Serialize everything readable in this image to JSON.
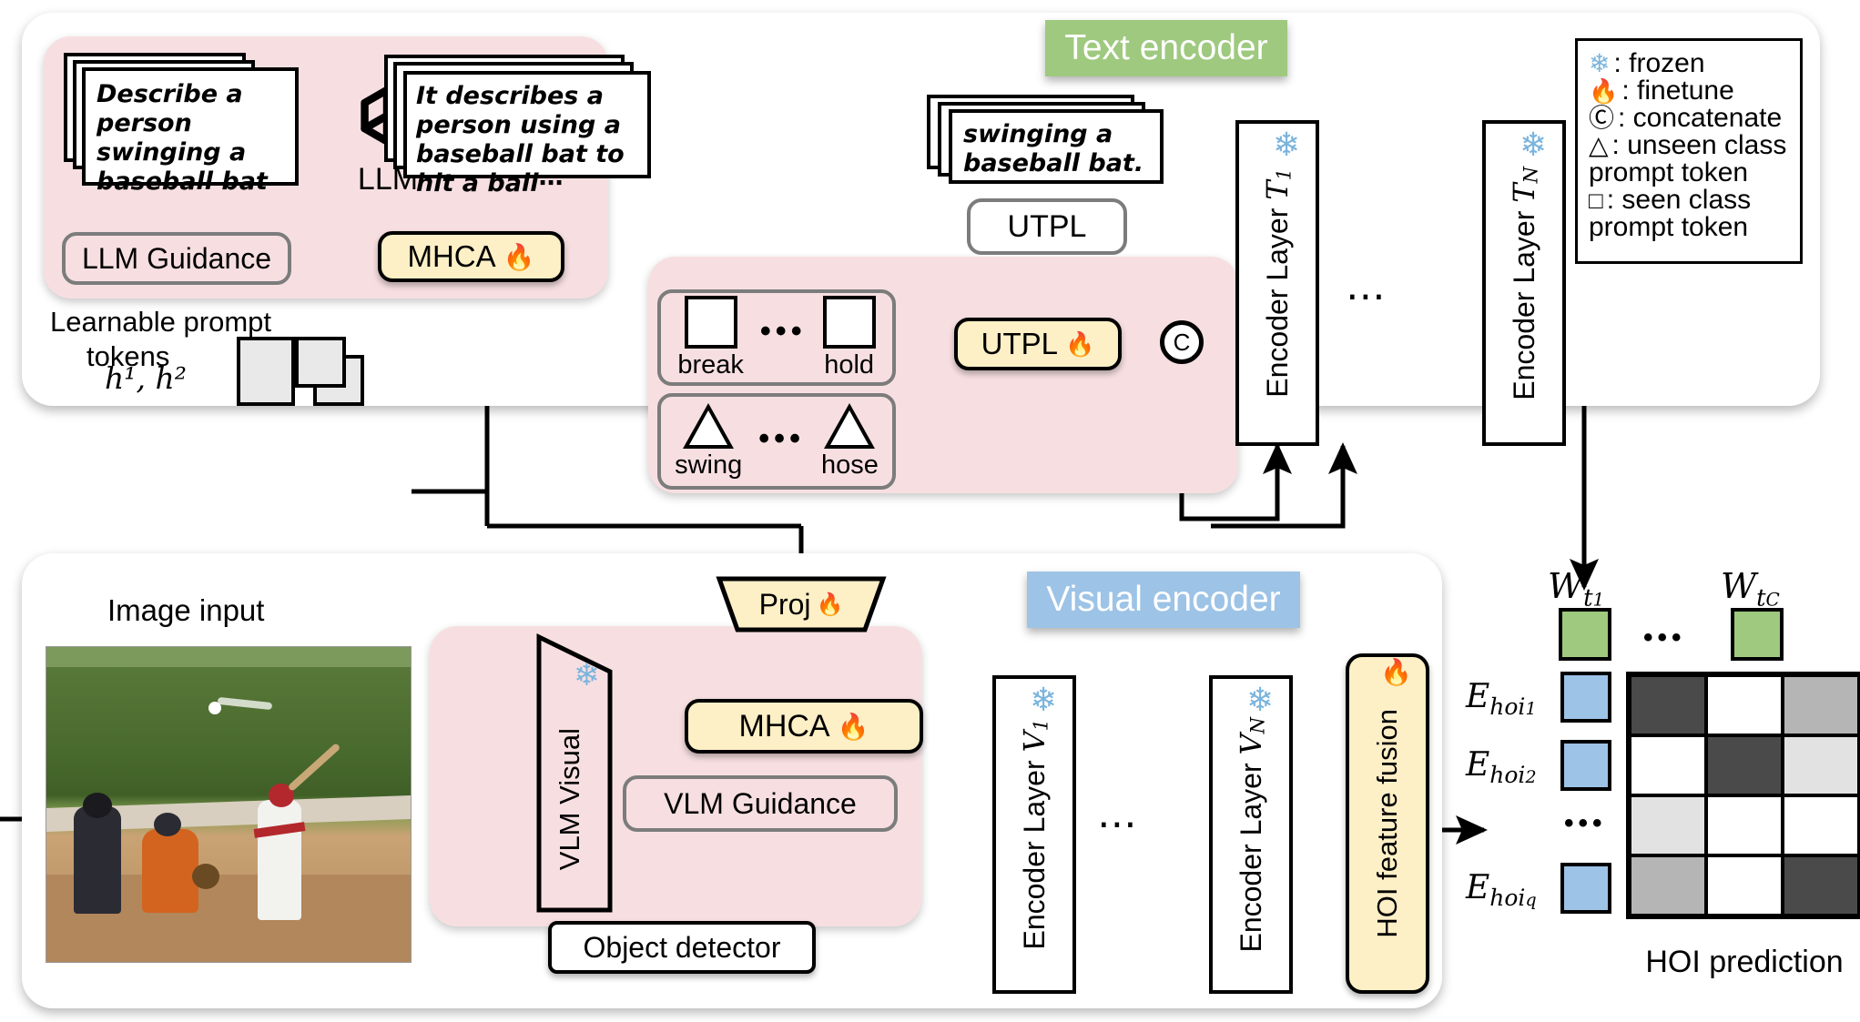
{
  "figure": {
    "text_encoder_tag": "Text encoder",
    "visual_encoder_tag": "Visual encoder",
    "text_encoder_color": "#9ec97f",
    "visual_encoder_color": "#9dc3e6"
  },
  "legend": {
    "items": [
      {
        "icon": "snowflake-icon",
        "glyph": "❄",
        "text": ": frozen"
      },
      {
        "icon": "fire-icon",
        "glyph": "🔥",
        "text": ": finetune"
      },
      {
        "icon": "concat-circle-icon",
        "glyph": "Ⓒ",
        "text": ": concatenate"
      },
      {
        "icon": "triangle-icon",
        "glyph": "△",
        "text": ": unseen class"
      },
      {
        "icon": "none",
        "glyph": "",
        "text": "prompt token"
      },
      {
        "icon": "square-icon",
        "glyph": "□",
        "text": ": seen class"
      },
      {
        "icon": "none",
        "glyph": "",
        "text": "prompt token"
      }
    ]
  },
  "llm_guidance": {
    "prompt_doc": "Describe a person swinging a baseball bat",
    "llm_label": "LLM",
    "llm_icon": "openai-logo-icon",
    "response_doc": "It describes a person using a baseball bat to hit a ball⋯",
    "group_label": "LLM Guidance",
    "mhca_label": "MHCA",
    "mhca_icon": "fire-icon"
  },
  "learnable_prompts": {
    "caption_line1": "Learnable prompt",
    "caption_line2": "tokens",
    "math": "h¹, h²"
  },
  "prompt_tokens": {
    "seen": {
      "left_label": "break",
      "right_label": "hold",
      "dots": "•••",
      "shape": "square"
    },
    "unseen": {
      "left_label": "swing",
      "right_label": "hose",
      "dots": "•••",
      "shape": "triangle"
    },
    "utpl_frozen_label": "UTPL",
    "utpl_finetune_label": "UTPL",
    "utpl_icon": "fire-icon",
    "concat_glyph": "C"
  },
  "text_branch": {
    "sentence_doc": "swinging a baseball bat.",
    "encoder_first": "Encoder Layer T₁",
    "encoder_first_base": "Encoder Layer ",
    "encoder_first_sub": "T",
    "encoder_first_idx": "1",
    "encoder_last_base": "Encoder Layer ",
    "encoder_last_sub": "T",
    "encoder_last_idx": "N",
    "ellipsis": "⋯",
    "snow_icon": "snowflake-icon"
  },
  "visual_branch": {
    "image_input_label": "Image input",
    "image_caption": "baseball batter swinging at home plate with catcher and umpire",
    "vlm_visual_label": "VLM Visual",
    "vlm_guidance_label": "VLM Guidance",
    "proj_label": "Proj",
    "proj_icon": "fire-icon",
    "mhca_label": "MHCA",
    "mhca_icon": "fire-icon",
    "object_detector_label": "Object detector",
    "encoder_first_base": "Encoder Layer ",
    "encoder_first_sub": "V",
    "encoder_first_idx": "1",
    "encoder_last_base": "Encoder Layer ",
    "encoder_last_sub": "V",
    "encoder_last_idx": "N",
    "ellipsis": "⋯",
    "fusion_label": "HOI feature fusion",
    "fusion_icon": "fire-icon",
    "snow_icon": "snowflake-icon"
  },
  "prediction": {
    "title": "HOI prediction",
    "col_labels": [
      "W",
      "W"
    ],
    "col_sub_first": "t",
    "col_sub_first_idx": "1",
    "col_sub_last": "t",
    "col_sub_last_idx": "C",
    "col_dots": "•••",
    "row_labels": [
      "E",
      "E",
      "E"
    ],
    "row_sub": "hoi",
    "row_idx": [
      "1",
      "2",
      "q"
    ],
    "row_dots": "•••",
    "text_swatch_color": "#9ec97f",
    "hoi_swatch_color": "#9dc3e6",
    "matrix": [
      [
        "#4a4a4a",
        "#ffffff",
        "#b5b5b5"
      ],
      [
        "#ffffff",
        "#4a4a4a",
        "#e2e2e2"
      ],
      [
        "#e2e2e2",
        "#ffffff",
        "#ffffff"
      ],
      [
        "#b5b5b5",
        "#ffffff",
        "#4a4a4a"
      ]
    ]
  }
}
